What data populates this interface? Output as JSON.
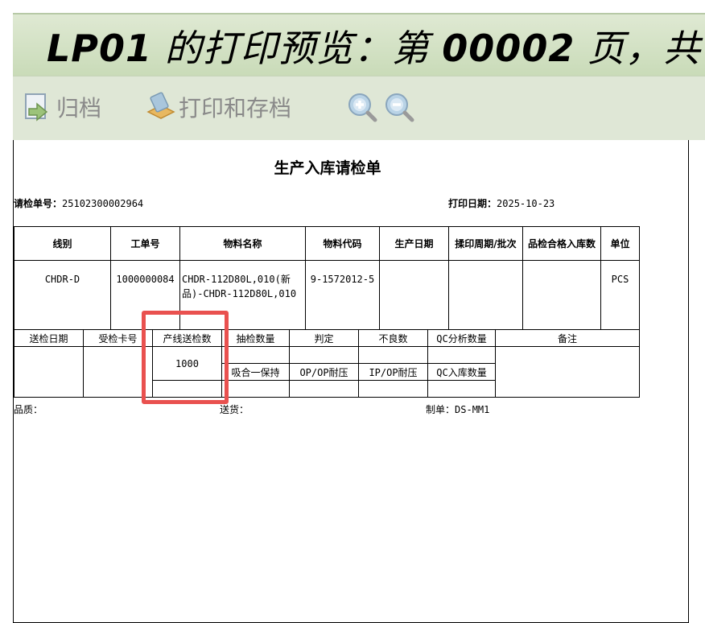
{
  "window": {
    "title_prefix": "LP01",
    "title_mid": " 的打印预览：第 ",
    "page_no": "00002",
    "title_suffix": " 页，共"
  },
  "toolbar": {
    "archive_label": "归档",
    "print_archive_label": "打印和存档"
  },
  "doc": {
    "title": "生产入库请检单",
    "inspect_no_label": "请检单号：",
    "inspect_no": "25102300002964",
    "print_date_label": "打印日期：",
    "print_date": "2025-10-23"
  },
  "table1": {
    "headers": [
      "线别",
      "工单号",
      "物料名称",
      "物料代码",
      "生产日期",
      "揉印周期/批次",
      "品检合格入库数",
      "单位"
    ],
    "row": [
      "CHDR-D",
      "1000000084",
      "CHDR-112D80L,010(新品)-CHDR-112D80L,010",
      "9-1572012-5",
      "",
      "",
      "",
      "PCS"
    ]
  },
  "table2": {
    "headers": [
      "送检日期",
      "受检卡号",
      "产线送检数",
      "抽检数量",
      "判定",
      "不良数",
      "QC分析数量",
      "备注"
    ],
    "qty": "1000",
    "sub_labels": [
      "吸合一保持",
      "OP/OP耐压",
      "IP/OP耐压",
      "QC入库数量"
    ]
  },
  "footer": {
    "quality_label": "品质：",
    "delivery_label": "送货：",
    "maker_label": "制单：",
    "maker": "DS-MM1"
  }
}
